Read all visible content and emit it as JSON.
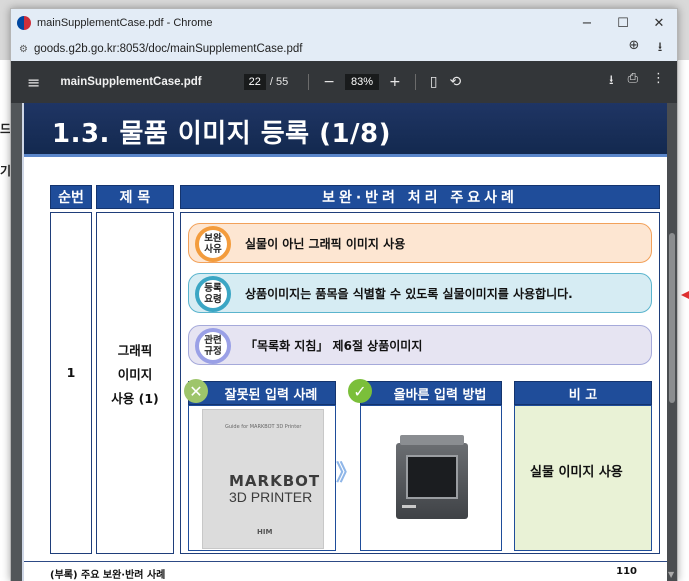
{
  "window": {
    "title": "mainSupplementCase.pdf - Chrome",
    "minimize": "−",
    "maximize": "☐",
    "close": "✕"
  },
  "address_bar": {
    "site_info": "⚙",
    "url": "goods.g2b.go.kr:8053/doc/mainSupplementCase.pdf",
    "zoom_icon": "⊕",
    "download_icon": "⭳"
  },
  "pdf_toolbar": {
    "menu": "≡",
    "filename": "mainSupplementCase.pdf",
    "current_page": "22",
    "page_total": "/ 55",
    "zoom_out": "−",
    "zoom": "83%",
    "zoom_in": "+",
    "fit": "▯",
    "rotate": "⟲",
    "download": "⭳",
    "print": "⎙",
    "more": "⋮"
  },
  "background_page": {
    "left_text_1": "드",
    "left_text_2": "기"
  },
  "slide": {
    "title": "1.3. 물품 이미지 등록 (1/8)",
    "headers": {
      "col1": "순번",
      "col2": "제 목",
      "col3": "보완·반려 처리 주요사례"
    },
    "row_number": "1",
    "row_title_line1": "그래픽",
    "row_title_line2": "이미지",
    "row_title_line3": "사용 (1)",
    "reason": {
      "badge_line1": "보완",
      "badge_line2": "사유",
      "text": "실물이 아닌 그래픽 이미지 사용",
      "color": "#f39c3d"
    },
    "requirement": {
      "badge_line1": "등록",
      "badge_line2": "요령",
      "text": "상품이미지는 품목을 식별할 수 있도록 실물이미지를 사용합니다.",
      "color": "#3ba6c4"
    },
    "regulation": {
      "badge_line1": "관련",
      "badge_line2": "규정",
      "text": "「목록화 지침」 제6절 상품이미지",
      "color": "#9aa0e6"
    },
    "wrong_header": "잘못된 입력 사례",
    "right_header": "올바른 입력 방법",
    "note_header": "비 고",
    "note_text": "실물 이미지 사용",
    "wrong_image": {
      "small": "Guide for MARKBOT 3D Printer",
      "brand_line1": "MARKBOT",
      "brand_line2": "3D PRINTER",
      "foot": "HIM"
    },
    "arrow": "》",
    "footer_left": "(부록) 주요 보완·반려 사례",
    "footer_right": "110"
  }
}
